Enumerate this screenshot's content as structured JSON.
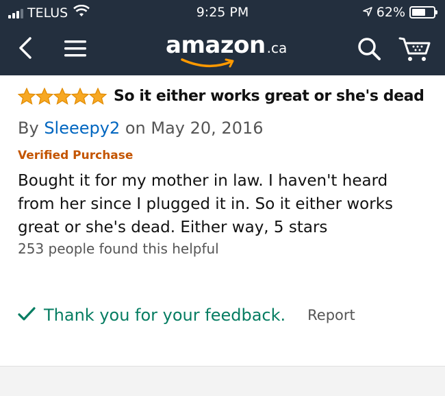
{
  "status_bar": {
    "carrier": "TELUS",
    "time": "9:25 PM",
    "battery_percent": "62%",
    "battery_level": 0.62,
    "icons": [
      "signal-icon",
      "wifi-icon",
      "location-arrow-icon",
      "battery-icon"
    ]
  },
  "nav": {
    "logo_word": "amazon",
    "logo_tld": ".ca",
    "icons": [
      "back-chevron-icon",
      "menu-icon",
      "search-icon",
      "cart-icon"
    ]
  },
  "review": {
    "rating": 5,
    "rating_max": 5,
    "title": "So it either works great or she's dead",
    "by_label": "By",
    "author": "Sleeepy2",
    "date": "on May 20, 2016",
    "verified": "Verified Purchase",
    "body_lines": [
      "Bought it for my mother in law. I haven't heard",
      "from her since I plugged it in. So it either works",
      "great or she's dead. Either way, 5 stars"
    ],
    "helpful": "253 people found this helpful"
  },
  "feedback": {
    "thanks": "Thank you for your feedback.",
    "report": "Report"
  },
  "colors": {
    "header_bg": "#232f3e",
    "star": "#f7a823",
    "link": "#0066c0",
    "verified": "#c45500",
    "success": "#067d62",
    "logo_smile": "#ff9900"
  }
}
